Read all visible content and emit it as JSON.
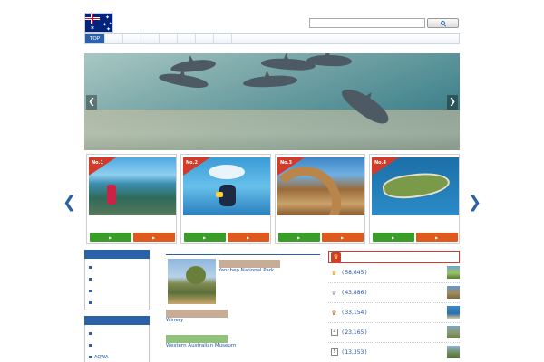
{
  "header": {
    "tagline": "",
    "site_title": "",
    "search": {
      "placeholder": "",
      "button_label": ""
    }
  },
  "nav": {
    "items": [
      {
        "label": "TOP",
        "active": true
      },
      {
        "label": ""
      },
      {
        "label": ""
      },
      {
        "label": ""
      },
      {
        "label": ""
      },
      {
        "label": ""
      },
      {
        "label": ""
      },
      {
        "label": ""
      }
    ]
  },
  "notice": "",
  "hero": {
    "caption_line1": "",
    "caption_line2": "",
    "prev_icon": "chevron-left-icon",
    "next_icon": "chevron-right-icon"
  },
  "tours": {
    "cards": [
      {
        "rank": "No.1",
        "name": "",
        "tour_button": "",
        "guide_button": ""
      },
      {
        "rank": "No.2",
        "name": "",
        "tour_button": "",
        "guide_button": ""
      },
      {
        "rank": "No.3",
        "name": "",
        "tour_button": "",
        "guide_button": ""
      },
      {
        "rank": "No.4",
        "name": "",
        "tour_button": "",
        "guide_button": ""
      }
    ]
  },
  "sidebar": {
    "sections": [
      {
        "heading": "",
        "items": [
          "",
          "",
          "",
          ""
        ]
      },
      {
        "heading": "",
        "items": [
          "",
          "",
          "AQWA"
        ]
      },
      {
        "heading": "",
        "items": []
      }
    ]
  },
  "news": {
    "heading": "",
    "items": [
      {
        "tag": "",
        "tag_color": "#c7ad95",
        "title": "Yanchep National Park",
        "body": ""
      },
      {
        "tag": "",
        "tag_color": "#c7ad95",
        "title": "Winery",
        "body": ""
      },
      {
        "tag": "",
        "tag_color": "#8fc27a",
        "title": "Western Australian Museum",
        "body": ""
      }
    ]
  },
  "ranking": {
    "heading": "",
    "subheading": "",
    "rows": [
      {
        "rank": "1",
        "label": "",
        "count": "58,645"
      },
      {
        "rank": "2",
        "label": "",
        "count": "43,886"
      },
      {
        "rank": "3",
        "label": "",
        "count": "33,154"
      },
      {
        "rank": "4",
        "label": "",
        "count": "23,165"
      },
      {
        "rank": "5",
        "label": "",
        "count": "13,353"
      }
    ]
  },
  "colors": {
    "accent_blue": "#2b62a7",
    "link_blue": "#2155a0",
    "ranking_red": "#d23a2a",
    "tour_green": "#3a9d2a",
    "guide_orange": "#e05a1f"
  }
}
